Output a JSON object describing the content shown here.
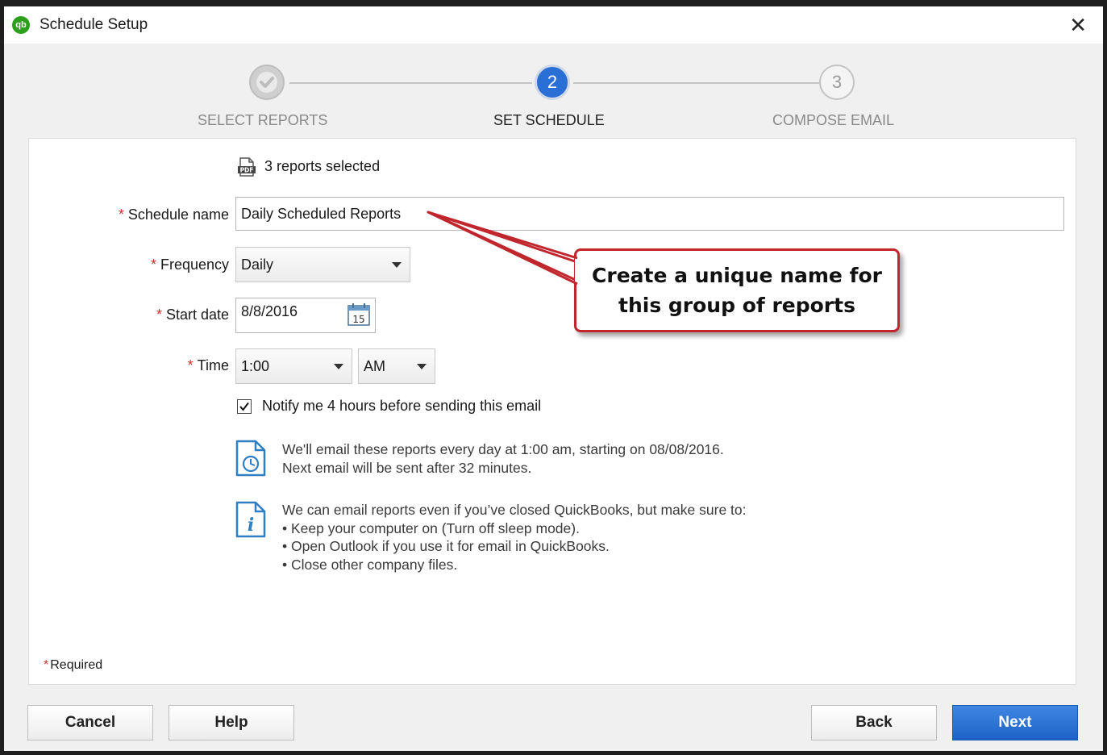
{
  "window": {
    "title": "Schedule Setup",
    "logo_text": "qb"
  },
  "stepper": {
    "steps": [
      {
        "number": "",
        "label": "SELECT REPORTS",
        "state": "completed"
      },
      {
        "number": "2",
        "label": "SET SCHEDULE",
        "state": "active"
      },
      {
        "number": "3",
        "label": "COMPOSE EMAIL",
        "state": "upcoming"
      }
    ]
  },
  "form": {
    "reports_selected": "3 reports selected",
    "required_mark": "*",
    "schedule_name": {
      "label": "Schedule name",
      "value": "Daily Scheduled Reports"
    },
    "frequency": {
      "label": "Frequency",
      "value": "Daily"
    },
    "start_date": {
      "label": "Start date",
      "value": "8/8/2016",
      "calendar_day": "15"
    },
    "time": {
      "label": "Time",
      "hour": "1:00",
      "ampm": "AM"
    },
    "notify": {
      "label": "Notify me 4 hours before sending this email",
      "checked": true
    }
  },
  "info": {
    "schedule_line1": "We'll email these reports every day at 1:00 am, starting on 08/08/2016.",
    "schedule_line2": "Next email will be sent after 32 minutes.",
    "tips_intro": "We can email reports even if you’ve closed QuickBooks, but make sure to:",
    "tips": [
      "• Keep your computer on (Turn off sleep mode).",
      "• Open Outlook if you use it for email in QuickBooks.",
      "• Close other company files."
    ]
  },
  "required_note": "Required",
  "callout": {
    "line1": "Create a unique name for",
    "line2": "this group of reports"
  },
  "buttons": {
    "cancel": "Cancel",
    "help": "Help",
    "back": "Back",
    "next": "Next"
  },
  "colors": {
    "accent": "#2a6fd6",
    "required": "#d0312d",
    "callout_border": "#c0272d",
    "qb_green": "#2ca01c"
  }
}
